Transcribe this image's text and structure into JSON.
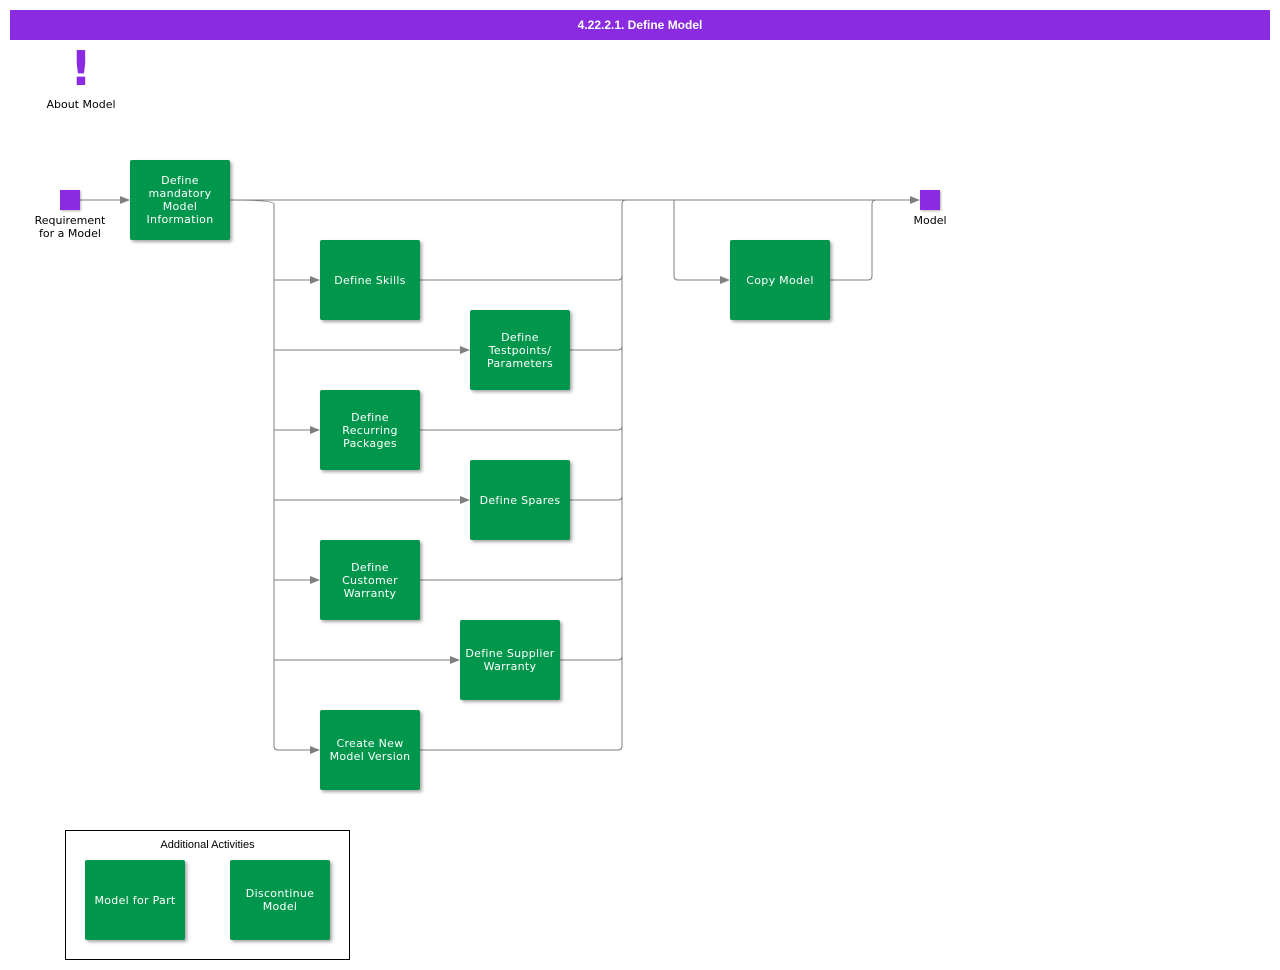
{
  "title": "4.22.2.1. Define Model",
  "about": {
    "label": "About Model"
  },
  "start": {
    "label": "Requirement\nfor a Model"
  },
  "end": {
    "label": "Model"
  },
  "nodes": {
    "mandatory": "Define\nmandatory\nModel\nInformation",
    "skills": "Define Skills",
    "testpoints": "Define\nTestpoints/\nParameters",
    "recurring": "Define Recurring\nPackages",
    "spares": "Define Spares",
    "customer_warranty": "Define\nCustomer\nWarranty",
    "supplier_warranty": "Define Supplier\nWarranty",
    "new_version": "Create New\nModel Version",
    "copy": "Copy Model"
  },
  "additional": {
    "title": "Additional Activities",
    "model_for_part": "Model for Part",
    "discontinue": "Discontinue\nModel"
  },
  "colors": {
    "accent": "#8a2be2",
    "activity": "#00964b",
    "connector": "#7f7f7f"
  }
}
